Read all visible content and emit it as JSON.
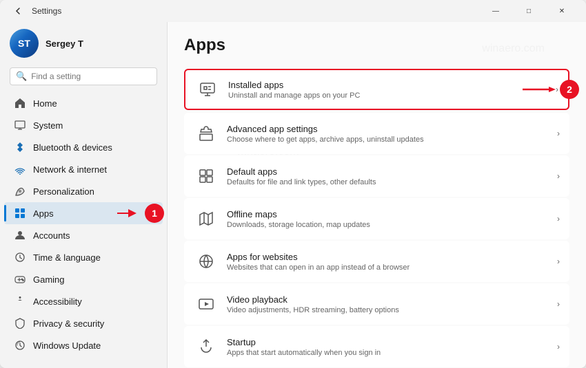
{
  "window": {
    "title": "Settings",
    "back_button": "←",
    "controls": {
      "minimize": "—",
      "maximize": "□",
      "close": "✕"
    }
  },
  "sidebar": {
    "user": {
      "name": "Sergey T"
    },
    "search": {
      "placeholder": "Find a setting"
    },
    "nav_items": [
      {
        "id": "home",
        "label": "Home",
        "icon": "home"
      },
      {
        "id": "system",
        "label": "System",
        "icon": "system"
      },
      {
        "id": "bluetooth",
        "label": "Bluetooth & devices",
        "icon": "bluetooth"
      },
      {
        "id": "network",
        "label": "Network & internet",
        "icon": "network"
      },
      {
        "id": "personalization",
        "label": "Personalization",
        "icon": "personalization"
      },
      {
        "id": "apps",
        "label": "Apps",
        "icon": "apps",
        "active": true
      },
      {
        "id": "accounts",
        "label": "Accounts",
        "icon": "accounts"
      },
      {
        "id": "time",
        "label": "Time & language",
        "icon": "time"
      },
      {
        "id": "gaming",
        "label": "Gaming",
        "icon": "gaming"
      },
      {
        "id": "accessibility",
        "label": "Accessibility",
        "icon": "accessibility"
      },
      {
        "id": "privacy",
        "label": "Privacy & security",
        "icon": "privacy"
      },
      {
        "id": "windows-update",
        "label": "Windows Update",
        "icon": "windows-update"
      }
    ]
  },
  "main": {
    "page_title": "Apps",
    "settings_items": [
      {
        "id": "installed-apps",
        "title": "Installed apps",
        "description": "Uninstall and manage apps on your PC",
        "highlighted": true,
        "badge": "2"
      },
      {
        "id": "advanced-app-settings",
        "title": "Advanced app settings",
        "description": "Choose where to get apps, archive apps, uninstall updates"
      },
      {
        "id": "default-apps",
        "title": "Default apps",
        "description": "Defaults for file and link types, other defaults"
      },
      {
        "id": "offline-maps",
        "title": "Offline maps",
        "description": "Downloads, storage location, map updates"
      },
      {
        "id": "apps-for-websites",
        "title": "Apps for websites",
        "description": "Websites that can open in an app instead of a browser"
      },
      {
        "id": "video-playback",
        "title": "Video playback",
        "description": "Video adjustments, HDR streaming, battery options"
      },
      {
        "id": "startup",
        "title": "Startup",
        "description": "Apps that start automatically when you sign in"
      }
    ]
  },
  "watermarks": [
    "winaero.com",
    "winaero.com",
    "winaero.com"
  ],
  "annotations": {
    "badge1_label": "1",
    "badge2_label": "2"
  }
}
